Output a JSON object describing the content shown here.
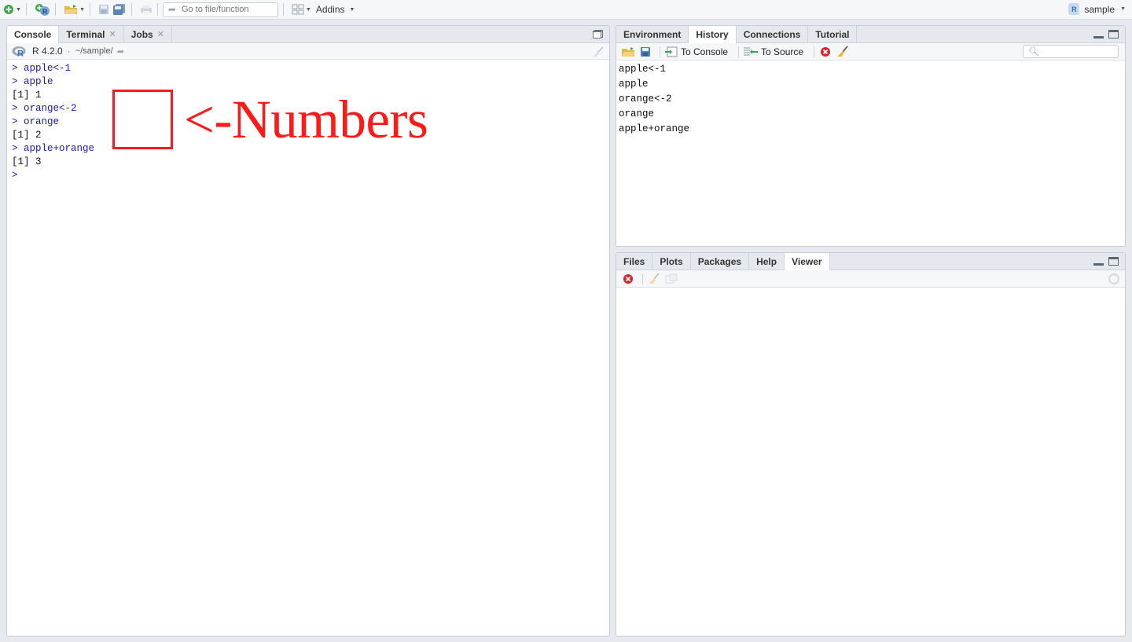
{
  "toolbar": {
    "goto_placeholder": "Go to file/function",
    "addins_label": "Addins",
    "project_label": "sample"
  },
  "left_pane": {
    "tabs": [
      {
        "label": "Console",
        "active": true
      },
      {
        "label": "Terminal",
        "closable": true
      },
      {
        "label": "Jobs",
        "closable": true
      }
    ],
    "r_version": "R 4.2.0",
    "separator": "·",
    "path": "~/sample/",
    "console_lines": [
      {
        "text": "> apple<-1",
        "kind": "input"
      },
      {
        "text": "> apple",
        "kind": "input"
      },
      {
        "text": "[1] 1",
        "kind": "output"
      },
      {
        "text": "> orange<-2",
        "kind": "input"
      },
      {
        "text": "> orange",
        "kind": "input"
      },
      {
        "text": "[1] 2",
        "kind": "output"
      },
      {
        "text": "> apple+orange",
        "kind": "input"
      },
      {
        "text": "[1] 3",
        "kind": "output"
      },
      {
        "text": ">",
        "kind": "input"
      }
    ],
    "annotation_text": "<-Numbers"
  },
  "top_right_pane": {
    "tabs": [
      {
        "label": "Environment"
      },
      {
        "label": "History",
        "active": true
      },
      {
        "label": "Connections"
      },
      {
        "label": "Tutorial"
      }
    ],
    "to_console_label": "To Console",
    "to_source_label": "To Source",
    "history_lines": [
      "apple<-1",
      "apple",
      "orange<-2",
      "orange",
      "apple+orange"
    ]
  },
  "bottom_right_pane": {
    "tabs": [
      {
        "label": "Files"
      },
      {
        "label": "Plots"
      },
      {
        "label": "Packages"
      },
      {
        "label": "Help"
      },
      {
        "label": "Viewer",
        "active": true
      }
    ]
  },
  "colors": {
    "console_input": "#1a1ab5",
    "annotation": "#ff1a1a"
  }
}
